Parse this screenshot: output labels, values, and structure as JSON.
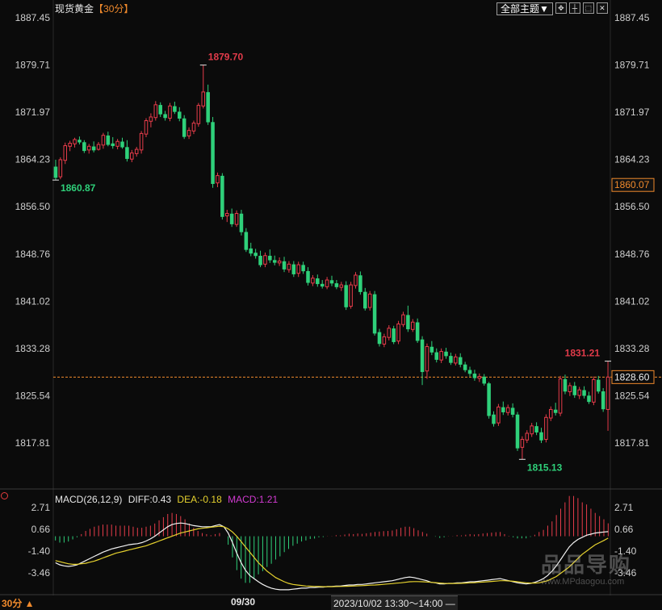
{
  "header": {
    "symbol": "现货黄金",
    "interval": "【30分】",
    "theme_button": "全部主题▼"
  },
  "toolbar_icons": [
    "move-icon",
    "crosshair-icon",
    "expand-icon",
    "close-icon"
  ],
  "chart_data": [
    {
      "type": "candlestick",
      "y_ticks": [
        1887.45,
        1879.71,
        1871.97,
        1864.23,
        1856.5,
        1848.76,
        1841.02,
        1833.28,
        1825.54,
        1817.81
      ],
      "y_tick_labels": [
        "1887.45",
        "1879.71",
        "1871.97",
        "1864.23",
        "1856.50",
        "1848.76",
        "1841.02",
        "1833.28",
        "1825.54",
        "1817.81"
      ],
      "ylim": [
        1816.0,
        1889.0
      ],
      "last_price": 1828.6,
      "last_price_label": "1828.60",
      "cursor_price_label": "1860.07",
      "annotations": [
        {
          "label": "1879.70",
          "value": 1879.7,
          "kind": "high"
        },
        {
          "label": "1860.87",
          "value": 1860.87,
          "kind": "low"
        },
        {
          "label": "1815.13",
          "value": 1815.13,
          "kind": "low"
        },
        {
          "label": "1831.21",
          "value": 1831.21,
          "kind": "high"
        }
      ],
      "candles": [
        [
          1863.0,
          1864.2,
          1860.9,
          1861.3
        ],
        [
          1861.4,
          1864.6,
          1861.0,
          1864.2
        ],
        [
          1864.1,
          1867.0,
          1863.5,
          1866.5
        ],
        [
          1866.4,
          1867.3,
          1865.6,
          1866.9
        ],
        [
          1866.8,
          1867.8,
          1866.2,
          1867.5
        ],
        [
          1867.4,
          1868.0,
          1866.7,
          1867.1
        ],
        [
          1867.0,
          1867.4,
          1865.3,
          1865.7
        ],
        [
          1865.8,
          1866.8,
          1865.2,
          1866.4
        ],
        [
          1866.3,
          1867.2,
          1865.4,
          1865.8
        ],
        [
          1865.9,
          1867.1,
          1865.7,
          1866.7
        ],
        [
          1866.6,
          1868.6,
          1866.0,
          1868.2
        ],
        [
          1868.1,
          1868.8,
          1866.4,
          1866.7
        ],
        [
          1866.8,
          1867.9,
          1866.0,
          1866.5
        ],
        [
          1866.4,
          1867.6,
          1865.9,
          1867.2
        ],
        [
          1867.1,
          1867.8,
          1866.0,
          1866.3
        ],
        [
          1866.2,
          1867.4,
          1863.9,
          1864.4
        ],
        [
          1864.3,
          1865.8,
          1863.8,
          1865.3
        ],
        [
          1865.2,
          1866.3,
          1864.7,
          1865.9
        ],
        [
          1865.8,
          1868.9,
          1865.2,
          1868.5
        ],
        [
          1868.4,
          1871.0,
          1867.9,
          1870.6
        ],
        [
          1870.5,
          1871.8,
          1869.5,
          1871.2
        ],
        [
          1871.1,
          1873.8,
          1870.6,
          1873.2
        ],
        [
          1873.1,
          1873.6,
          1871.2,
          1871.7
        ],
        [
          1871.6,
          1872.2,
          1870.6,
          1871.1
        ],
        [
          1871.0,
          1873.5,
          1870.5,
          1873.0
        ],
        [
          1872.9,
          1873.7,
          1871.7,
          1872.1
        ],
        [
          1872.0,
          1872.8,
          1870.5,
          1871.0
        ],
        [
          1870.9,
          1871.5,
          1867.6,
          1868.0
        ],
        [
          1868.1,
          1869.5,
          1867.6,
          1869.0
        ],
        [
          1868.9,
          1870.6,
          1868.4,
          1870.2
        ],
        [
          1870.1,
          1873.5,
          1869.6,
          1873.1
        ],
        [
          1873.0,
          1879.7,
          1872.6,
          1875.3
        ],
        [
          1875.2,
          1876.5,
          1869.9,
          1870.4
        ],
        [
          1870.3,
          1871.2,
          1859.6,
          1860.3
        ],
        [
          1860.4,
          1862.1,
          1859.7,
          1861.6
        ],
        [
          1861.5,
          1862.0,
          1854.4,
          1854.9
        ],
        [
          1855.0,
          1856.0,
          1854.0,
          1855.4
        ],
        [
          1855.3,
          1856.2,
          1853.2,
          1853.7
        ],
        [
          1853.6,
          1855.9,
          1853.2,
          1855.4
        ],
        [
          1855.3,
          1856.0,
          1851.8,
          1852.4
        ],
        [
          1852.3,
          1853.0,
          1849.1,
          1849.5
        ],
        [
          1849.6,
          1850.6,
          1848.4,
          1848.9
        ],
        [
          1848.9,
          1849.6,
          1848.0,
          1848.5
        ],
        [
          1848.4,
          1849.3,
          1846.6,
          1847.0
        ],
        [
          1847.1,
          1849.0,
          1846.6,
          1848.5
        ],
        [
          1848.4,
          1849.5,
          1847.3,
          1847.8
        ],
        [
          1847.7,
          1848.5,
          1846.9,
          1847.4
        ],
        [
          1847.3,
          1848.2,
          1846.8,
          1847.6
        ],
        [
          1847.5,
          1848.3,
          1845.8,
          1846.3
        ],
        [
          1846.2,
          1847.6,
          1845.7,
          1847.1
        ],
        [
          1847.0,
          1847.6,
          1845.0,
          1845.5
        ],
        [
          1845.6,
          1847.5,
          1845.0,
          1847.0
        ],
        [
          1846.9,
          1847.5,
          1845.5,
          1846.0
        ],
        [
          1845.9,
          1846.6,
          1843.6,
          1844.1
        ],
        [
          1844.0,
          1845.3,
          1843.5,
          1844.8
        ],
        [
          1844.7,
          1845.4,
          1843.4,
          1843.9
        ],
        [
          1843.8,
          1844.5,
          1843.1,
          1843.5
        ],
        [
          1843.4,
          1845.0,
          1843.0,
          1844.5
        ],
        [
          1844.4,
          1845.2,
          1843.5,
          1844.0
        ],
        [
          1843.9,
          1844.5,
          1843.0,
          1843.4
        ],
        [
          1843.3,
          1844.2,
          1842.7,
          1843.7
        ],
        [
          1843.6,
          1844.3,
          1839.6,
          1840.1
        ],
        [
          1840.2,
          1844.2,
          1839.8,
          1843.7
        ],
        [
          1843.6,
          1845.8,
          1843.1,
          1845.3
        ],
        [
          1845.2,
          1845.9,
          1842.1,
          1842.6
        ],
        [
          1842.5,
          1843.2,
          1839.5,
          1839.9
        ],
        [
          1840.0,
          1842.7,
          1839.5,
          1842.2
        ],
        [
          1842.1,
          1842.7,
          1835.4,
          1835.8
        ],
        [
          1835.9,
          1836.5,
          1833.6,
          1834.1
        ],
        [
          1834.0,
          1835.7,
          1833.5,
          1835.2
        ],
        [
          1835.1,
          1837.1,
          1834.6,
          1836.6
        ],
        [
          1836.5,
          1837.0,
          1834.0,
          1834.4
        ],
        [
          1834.5,
          1837.8,
          1834.0,
          1837.3
        ],
        [
          1837.2,
          1839.3,
          1836.8,
          1838.8
        ],
        [
          1838.7,
          1840.3,
          1836.0,
          1836.5
        ],
        [
          1836.4,
          1838.1,
          1836.0,
          1837.6
        ],
        [
          1837.5,
          1838.2,
          1834.2,
          1834.6
        ],
        [
          1834.7,
          1835.3,
          1827.3,
          1829.5
        ],
        [
          1829.6,
          1834.1,
          1828.3,
          1833.6
        ],
        [
          1833.5,
          1834.5,
          1832.2,
          1832.7
        ],
        [
          1832.6,
          1833.3,
          1831.0,
          1831.5
        ],
        [
          1831.4,
          1833.3,
          1830.9,
          1832.8
        ],
        [
          1832.7,
          1833.4,
          1831.6,
          1832.1
        ],
        [
          1832.0,
          1832.6,
          1830.6,
          1831.0
        ],
        [
          1830.9,
          1832.4,
          1830.5,
          1831.9
        ],
        [
          1831.8,
          1832.5,
          1830.2,
          1830.7
        ],
        [
          1830.6,
          1831.1,
          1829.4,
          1829.8
        ],
        [
          1829.7,
          1830.3,
          1828.7,
          1829.2
        ],
        [
          1829.1,
          1829.8,
          1828.0,
          1828.5
        ],
        [
          1828.4,
          1829.2,
          1827.8,
          1828.7
        ],
        [
          1828.6,
          1829.1,
          1827.2,
          1827.6
        ],
        [
          1827.5,
          1827.8,
          1821.8,
          1822.3
        ],
        [
          1822.4,
          1823.0,
          1820.5,
          1821.0
        ],
        [
          1821.1,
          1824.2,
          1820.6,
          1823.7
        ],
        [
          1823.6,
          1824.6,
          1822.4,
          1822.9
        ],
        [
          1822.8,
          1824.1,
          1822.3,
          1823.6
        ],
        [
          1823.5,
          1824.3,
          1822.0,
          1822.5
        ],
        [
          1822.4,
          1822.9,
          1816.5,
          1817.0
        ],
        [
          1817.1,
          1818.9,
          1815.1,
          1818.4
        ],
        [
          1818.3,
          1819.9,
          1817.8,
          1819.4
        ],
        [
          1819.3,
          1821.1,
          1818.8,
          1820.6
        ],
        [
          1820.5,
          1821.2,
          1819.1,
          1819.6
        ],
        [
          1819.5,
          1820.3,
          1817.8,
          1818.3
        ],
        [
          1818.4,
          1822.5,
          1817.9,
          1822.0
        ],
        [
          1821.9,
          1823.8,
          1821.4,
          1823.3
        ],
        [
          1823.2,
          1824.4,
          1822.3,
          1822.8
        ],
        [
          1822.7,
          1828.8,
          1822.2,
          1828.3
        ],
        [
          1828.2,
          1829.0,
          1825.8,
          1826.3
        ],
        [
          1826.2,
          1827.7,
          1825.5,
          1827.2
        ],
        [
          1827.1,
          1827.8,
          1825.2,
          1825.7
        ],
        [
          1825.6,
          1827.0,
          1825.0,
          1826.5
        ],
        [
          1826.4,
          1827.1,
          1825.1,
          1825.6
        ],
        [
          1825.5,
          1826.2,
          1824.2,
          1824.6
        ],
        [
          1824.5,
          1828.7,
          1824.0,
          1828.2
        ],
        [
          1828.1,
          1828.8,
          1825.9,
          1826.3
        ],
        [
          1826.2,
          1826.8,
          1822.9,
          1823.4
        ],
        [
          1823.3,
          1831.2,
          1819.8,
          1828.6
        ]
      ]
    },
    {
      "type": "macd",
      "name": "MACD(26,12,9)",
      "diff_label": "DIFF:0.43",
      "dea_label": "DEA:-0.18",
      "macd_label": "MACD:1.21",
      "y_ticks": [
        2.71,
        0.66,
        -1.4,
        -3.46
      ],
      "y_tick_labels": [
        "2.71",
        "0.66",
        "-1.40",
        "-3.46"
      ],
      "ylim": [
        -5.2,
        3.3
      ],
      "x_label": "09/30",
      "diff": [
        -2.5,
        -2.7,
        -2.8,
        -2.85,
        -2.8,
        -2.7,
        -2.5,
        -2.3,
        -2.1,
        -1.9,
        -1.7,
        -1.5,
        -1.35,
        -1.2,
        -1.1,
        -1.0,
        -0.9,
        -0.8,
        -0.75,
        -0.7,
        -0.6,
        -0.45,
        -0.25,
        0.0,
        0.3,
        0.6,
        0.9,
        1.1,
        1.2,
        1.25,
        1.2,
        1.1,
        1.0,
        0.95,
        0.9,
        0.9,
        0.9,
        1.0,
        1.1,
        0.9,
        0.3,
        -0.6,
        -1.6,
        -2.5,
        -3.2,
        -3.7,
        -4.0,
        -4.3,
        -4.55,
        -4.75,
        -4.9,
        -5.0,
        -5.05,
        -5.05,
        -5.05,
        -5.0,
        -4.95,
        -4.9,
        -4.9,
        -4.85,
        -4.85,
        -4.8,
        -4.8,
        -4.75,
        -4.75,
        -4.7,
        -4.7,
        -4.65,
        -4.6,
        -4.6,
        -4.55,
        -4.55,
        -4.5,
        -4.45,
        -4.4,
        -4.35,
        -4.3,
        -4.25,
        -4.2,
        -4.1,
        -4.0,
        -3.9,
        -3.85,
        -3.9,
        -4.0,
        -4.1,
        -4.2,
        -4.35,
        -4.4,
        -4.5,
        -4.5,
        -4.45,
        -4.45,
        -4.4,
        -4.4,
        -4.35,
        -4.3,
        -4.3,
        -4.25,
        -4.2,
        -4.15,
        -4.1,
        -4.05,
        -4.0,
        -4.1,
        -4.2,
        -4.3,
        -4.4,
        -4.45,
        -4.5,
        -4.45,
        -4.35,
        -4.2,
        -4.0,
        -3.7,
        -3.3,
        -2.8,
        -2.2,
        -1.6,
        -1.0,
        -0.6,
        -0.3,
        -0.1,
        0.1,
        0.2,
        0.3,
        0.35,
        0.4,
        0.43
      ],
      "dea": [
        -2.3,
        -2.4,
        -2.5,
        -2.6,
        -2.65,
        -2.65,
        -2.6,
        -2.55,
        -2.45,
        -2.35,
        -2.2,
        -2.05,
        -1.9,
        -1.75,
        -1.6,
        -1.5,
        -1.4,
        -1.3,
        -1.2,
        -1.1,
        -1.0,
        -0.9,
        -0.75,
        -0.6,
        -0.45,
        -0.3,
        -0.15,
        0.0,
        0.15,
        0.3,
        0.4,
        0.5,
        0.6,
        0.7,
        0.75,
        0.8,
        0.85,
        0.9,
        0.95,
        0.9,
        0.7,
        0.4,
        0.0,
        -0.5,
        -1.0,
        -1.5,
        -2.0,
        -2.5,
        -2.9,
        -3.3,
        -3.6,
        -3.9,
        -4.1,
        -4.3,
        -4.45,
        -4.55,
        -4.6,
        -4.65,
        -4.7,
        -4.72,
        -4.74,
        -4.75,
        -4.76,
        -4.76,
        -4.76,
        -4.75,
        -4.74,
        -4.73,
        -4.72,
        -4.7,
        -4.68,
        -4.66,
        -4.64,
        -4.62,
        -4.6,
        -4.57,
        -4.54,
        -4.5,
        -4.47,
        -4.43,
        -4.4,
        -4.35,
        -4.3,
        -4.28,
        -4.28,
        -4.3,
        -4.32,
        -4.35,
        -4.38,
        -4.42,
        -4.45,
        -4.46,
        -4.46,
        -4.45,
        -4.44,
        -4.42,
        -4.4,
        -4.38,
        -4.35,
        -4.33,
        -4.3,
        -4.27,
        -4.24,
        -4.2,
        -4.2,
        -4.22,
        -4.25,
        -4.3,
        -4.35,
        -4.4,
        -4.42,
        -4.42,
        -4.4,
        -4.3,
        -4.2,
        -4.0,
        -3.8,
        -3.5,
        -3.2,
        -2.9,
        -2.5,
        -2.1,
        -1.7,
        -1.4,
        -1.1,
        -0.8,
        -0.6,
        -0.4,
        -0.18
      ]
    }
  ]
}
